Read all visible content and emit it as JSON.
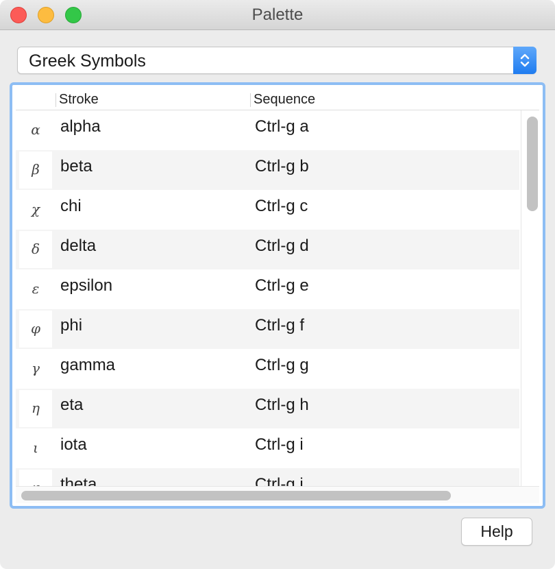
{
  "window": {
    "title": "Palette",
    "controls": [
      "close-button",
      "minimize-button",
      "zoom-button"
    ]
  },
  "dropdown": {
    "selected": "Greek Symbols",
    "accent": "#2a82f3"
  },
  "table": {
    "columns": [
      "Stroke",
      "Sequence"
    ],
    "rows": [
      {
        "symbol": "α",
        "stroke": "alpha",
        "sequence": "Ctrl-g a"
      },
      {
        "symbol": "β",
        "stroke": "beta",
        "sequence": "Ctrl-g b"
      },
      {
        "symbol": "χ",
        "stroke": "chi",
        "sequence": "Ctrl-g c"
      },
      {
        "symbol": "δ",
        "stroke": "delta",
        "sequence": "Ctrl-g d"
      },
      {
        "symbol": "ε",
        "stroke": "epsilon",
        "sequence": "Ctrl-g e"
      },
      {
        "symbol": "φ",
        "stroke": "phi",
        "sequence": "Ctrl-g f"
      },
      {
        "symbol": "γ",
        "stroke": "gamma",
        "sequence": "Ctrl-g g"
      },
      {
        "symbol": "η",
        "stroke": "eta",
        "sequence": "Ctrl-g h"
      },
      {
        "symbol": "ι",
        "stroke": "iota",
        "sequence": "Ctrl-g i"
      },
      {
        "symbol": "φ",
        "stroke": "theta",
        "sequence": "Ctrl-g j"
      }
    ]
  },
  "footer": {
    "help_label": "Help"
  },
  "colors": {
    "selection_border": "#8dbdf4",
    "row_alternate": "#f4f4f4"
  }
}
